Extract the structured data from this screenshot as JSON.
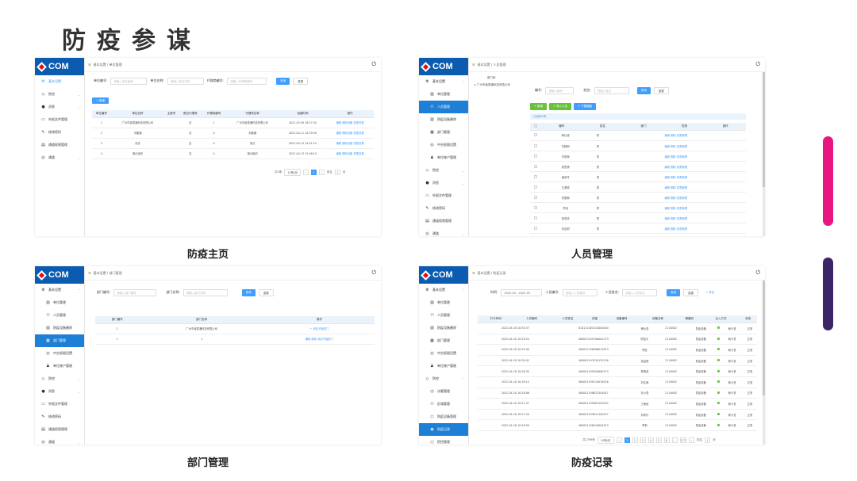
{
  "page_title": "防疫参谋",
  "logo_text": "COM",
  "colors": {
    "accent": "#409eff",
    "sidebar_active": "#1e7fd6",
    "logo_bg": "#0b5bb0",
    "bar_pink": "#e8177f",
    "bar_purple": "#3c2468"
  },
  "captions": [
    "防疫主页",
    "人员管理",
    "部门管理",
    "防疫记录"
  ],
  "sidebar": {
    "main": "基本设置",
    "groups": [
      "防控",
      "消息",
      "外报文件管理",
      "修改密码",
      "通道权限管理",
      "通道"
    ],
    "sub": [
      "单位管理",
      "人员管理",
      "防疫设备删除",
      "部门管理",
      "中台权限设置",
      "单位账户管理"
    ],
    "fk_sub": [
      "访客管理",
      "区域管理",
      "防疫设备管理",
      "防疫记录",
      "防控管理"
    ]
  },
  "p1": {
    "breadcrumb": "基本设置 / 单位管理",
    "fields": [
      {
        "label": "单位编号:",
        "ph": "请输入单位编号"
      },
      {
        "label": "单位名称:",
        "ph": "请输入单位名称"
      },
      {
        "label": "代理商编号:",
        "ph": "请输入代理商编号"
      }
    ],
    "search": "查询",
    "reset": "重置",
    "add": "+ 新增",
    "headers": [
      "单位编号",
      "单位名称",
      "主账号",
      "是否代理商",
      "代理商编号",
      "代理商名称",
      "创建时间",
      "操作"
    ],
    "rows": [
      [
        "1",
        "广州市鑫泰通科技有限公司",
        "",
        "否",
        "1",
        "广州市鑫泰通科技有限公司",
        "2022-03-09 18:27:20",
        "编辑 删除设备 权限设置"
      ],
      [
        "2",
        "丰趣通",
        "",
        "否",
        "0",
        "丰趣通",
        "2022-04-11 10:29:28",
        ""
      ],
      [
        "3",
        "测试",
        "",
        "否",
        "0",
        "测试",
        "2022-04-13 14:41:15",
        ""
      ],
      [
        "4",
        "演示组织",
        "",
        "否",
        "0",
        "演示组织",
        "2022-04-13 15:48:15",
        ""
      ]
    ],
    "ops": [
      "编辑",
      "删除设备",
      "权限设置"
    ],
    "total": "共4条",
    "per_page": "10条/页",
    "page": "1",
    "goto": "前往",
    "goto_page": "1",
    "page_unit": "页"
  },
  "p2": {
    "breadcrumb": "基本设置 / 人员管理",
    "tree": [
      "部门树",
      "广州市鑫泰通科技有限公司"
    ],
    "fields": [
      {
        "label": "编号:",
        "ph": "请输入编号"
      },
      {
        "label": "姓名:",
        "ph": "请输入姓名"
      }
    ],
    "search": "查询",
    "reset": "重置",
    "actions": [
      "+ 新增",
      "+ 导入人员",
      "+ 下载模板"
    ],
    "notice": "已选择0项",
    "headers": [
      "编号",
      "姓名",
      "部门",
      "性别",
      "操作"
    ],
    "names": [
      "黄仕强",
      "刘超明",
      "刘德海",
      "吴思静",
      "潘泽洋",
      "王源琦",
      "何丽娟",
      "李旭",
      "张成伟",
      "邓启明",
      "何志明"
    ],
    "gender": [
      "男",
      "男",
      "男",
      "男",
      "男",
      "男",
      "男",
      "男",
      "男",
      "男",
      "男"
    ],
    "ops": [
      "编辑",
      "删除",
      "权限管理"
    ]
  },
  "p3": {
    "breadcrumb": "基本设置 / 部门管理",
    "fields": [
      {
        "label": "部门编号:",
        "ph": "请输入部门编号"
      },
      {
        "label": "部门名称:",
        "ph": "请输入部门名称"
      }
    ],
    "search": "查询",
    "reset": "重置",
    "headers": [
      "部门编号",
      "部门名称",
      "操作"
    ],
    "rows": [
      [
        "1",
        "广州市鑫泰通科技有限公司",
        "+ 添加子级部门"
      ],
      [
        "1",
        "1",
        "编辑 删除 添加子级部门"
      ]
    ]
  },
  "p4": {
    "breadcrumb": "基本设置 / 防疫记录",
    "fields": [
      {
        "label": "时间:",
        "ph": "2022-04 - 2022-03"
      },
      {
        "label": "人员编号:",
        "ph": "请输入人员编号"
      },
      {
        "label": "人员姓名:",
        "ph": "请输入人员姓名"
      }
    ],
    "search": "查询",
    "reset": "重置",
    "export": "+ 导出",
    "headers": [
      "打卡时间",
      "人员编号",
      "人员姓名",
      "体温",
      "设备编号",
      "设备名称",
      "健康码",
      "出入方式",
      "状态"
    ],
    "times": [
      "2022-04-18 10:30:37",
      "2022-04-18 10:29:54",
      "2022-04-18 10:29:40",
      "2022-04-18 10:28:42",
      "2022-04-18 10:28:30",
      "2022-04-18 10:28:14",
      "2022-04-18 10:28:06",
      "2022-04-18 10:27:47",
      "2022-04-18 10:27:30",
      "2022-04-18 10:26:50"
    ],
    "ids": [
      "810111001010000000",
      "460023199706061473",
      "460022196906014813",
      "460001193310153126",
      "460001199304060313",
      "460001199210016516",
      "460001198612304627",
      "460001199003103032",
      "460001199612100527",
      "460001196010004523"
    ],
    "names": [
      "黄仕强",
      "陈金平",
      "李宏",
      "张运明",
      "周海波",
      "刘名海",
      "孙小燕",
      "王海波",
      "邓秀玲",
      "李莉"
    ],
    "devices": [
      "2116482",
      "2116482",
      "2116482",
      "2116482",
      "2116482",
      "2116482",
      "2116482",
      "2116482",
      "2116482",
      "2116482"
    ],
    "dev_name": "防疫设备",
    "enter": "刷卡进",
    "status": "正常",
    "total": "共1769条",
    "per_page": "10条/页",
    "pages": [
      "1",
      "2",
      "3",
      "4",
      "5",
      "6",
      "...",
      "177"
    ],
    "goto": "前往",
    "goto_page": "1",
    "page_unit": "页"
  }
}
